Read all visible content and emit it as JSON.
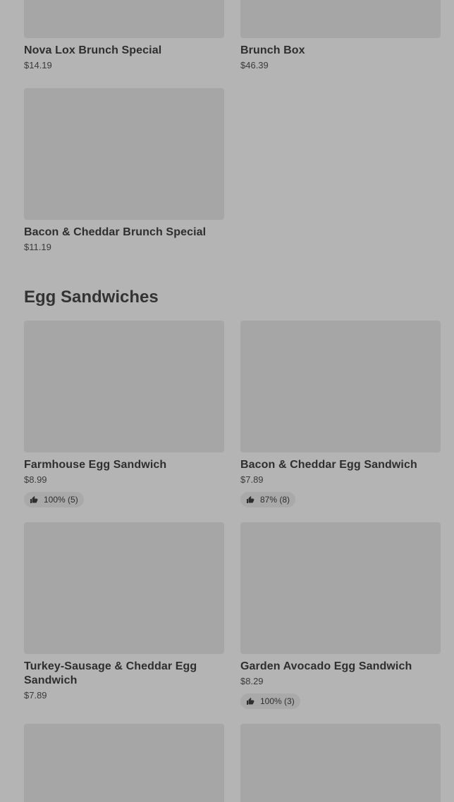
{
  "top_items": [
    {
      "name": "Nova Lox Brunch Special",
      "price": "$14.19"
    },
    {
      "name": "Brunch Box",
      "price": "$46.39"
    },
    {
      "name": "Bacon & Cheddar Brunch Special",
      "price": "$11.19"
    }
  ],
  "section": {
    "title": "Egg Sandwiches"
  },
  "egg_items": [
    {
      "name": "Farmhouse Egg Sandwich",
      "price": "$8.99",
      "rating": "100% (5)"
    },
    {
      "name": "Bacon & Cheddar Egg Sandwich",
      "price": "$7.89",
      "rating": "87% (8)"
    },
    {
      "name": "Turkey-Sausage & Cheddar Egg Sandwich",
      "price": "$7.89"
    },
    {
      "name": "Garden Avocado Egg Sandwich",
      "price": "$8.29",
      "rating": "100% (3)"
    }
  ],
  "icons": {
    "rating": "thumbs-up-icon"
  }
}
